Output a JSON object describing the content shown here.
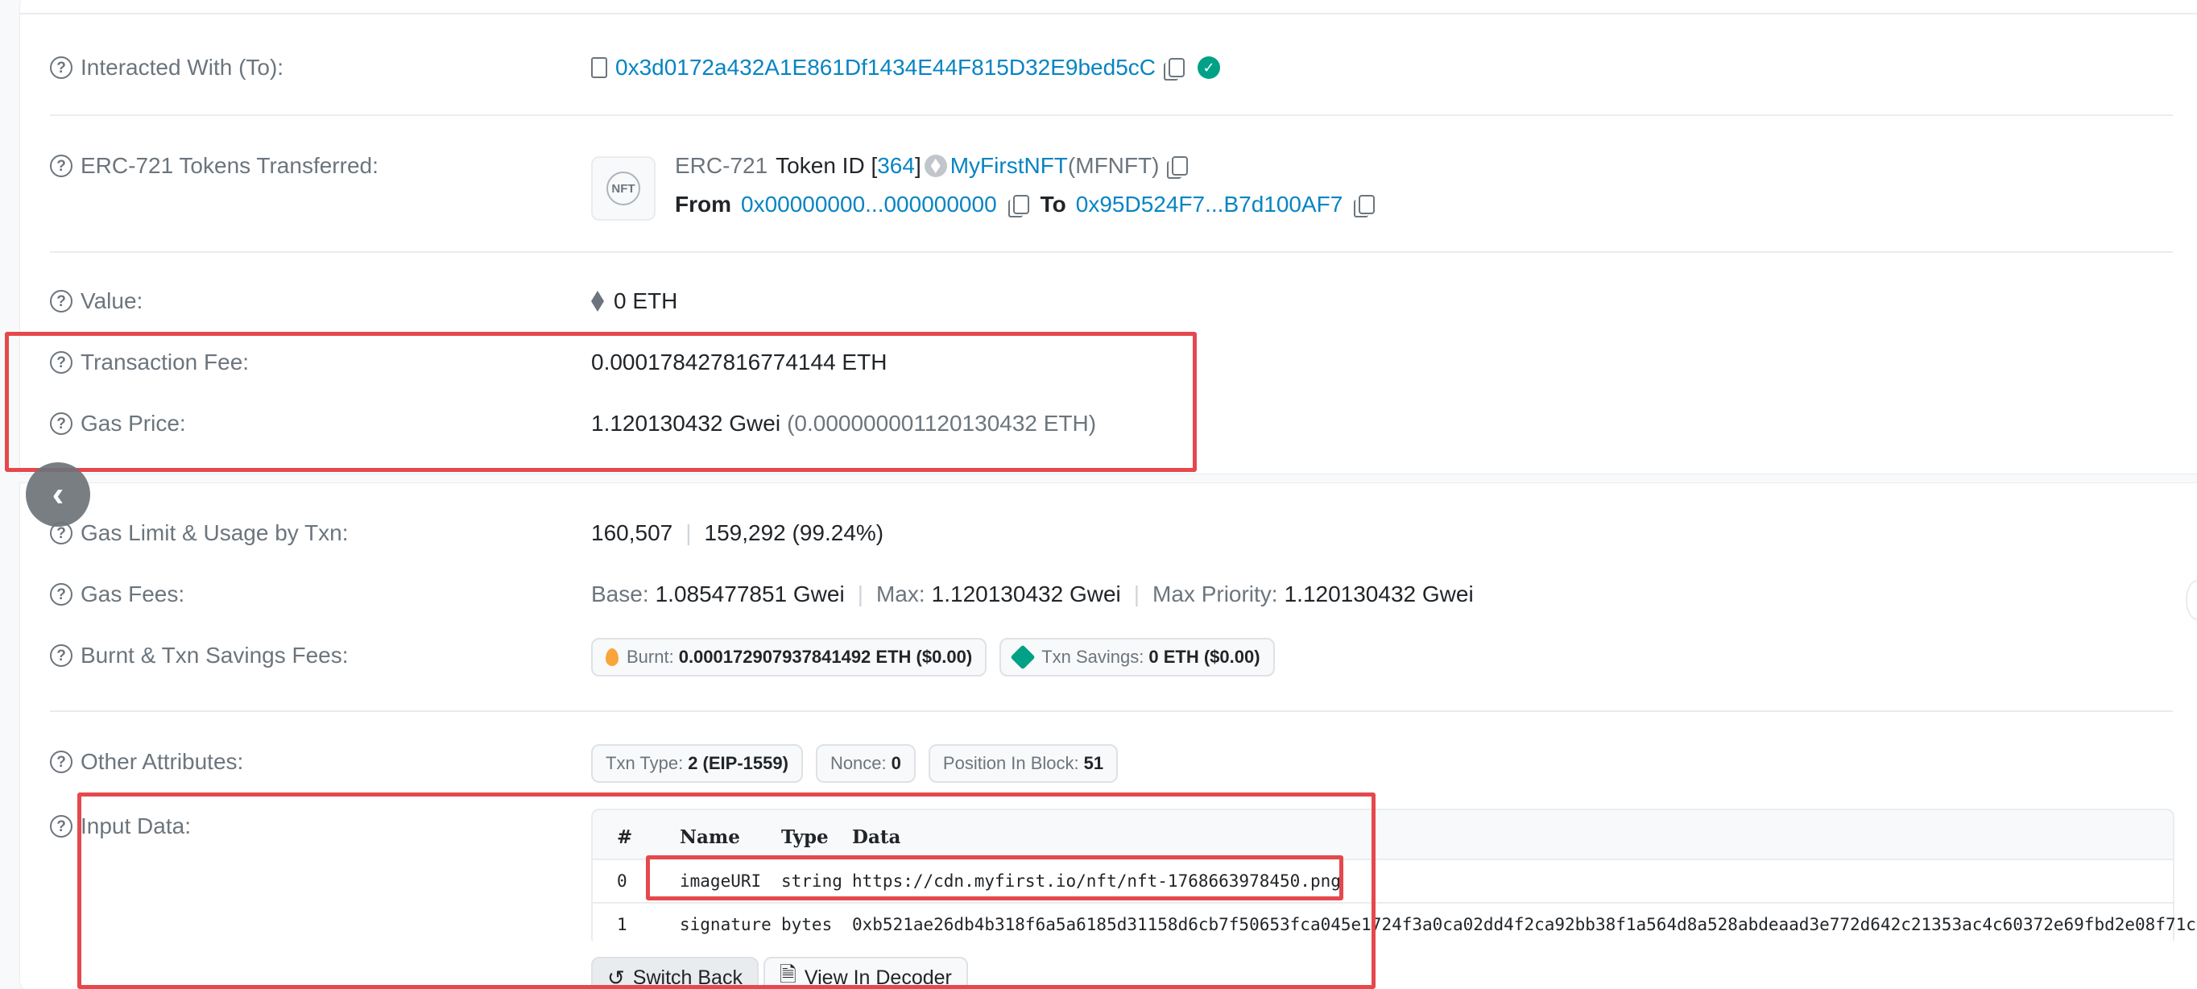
{
  "rows": {
    "interacted_with": {
      "label": "Interacted With (To):",
      "address": "0x3d0172a432A1E861Df1434E44F815D32E9bed5cC"
    },
    "erc721": {
      "label": "ERC-721 Tokens Transferred:",
      "standard": "ERC-721",
      "token_id_prefix": "Token ID [",
      "token_id": "364",
      "token_id_suffix": "]",
      "token_name": "MyFirstNFT",
      "token_symbol": "(MFNFT)",
      "from_label": "From",
      "from_address": "0x00000000...000000000",
      "to_label": "To",
      "to_address": "0x95D524F7...B7d100AF7",
      "thumbnail_text": "NFT"
    },
    "value": {
      "label": "Value:",
      "amount": "0 ETH"
    },
    "transaction_fee": {
      "label": "Transaction Fee:",
      "amount": "0.000178427816774144 ETH"
    },
    "gas_price": {
      "label": "Gas Price:",
      "gwei": "1.120130432 Gwei",
      "eth": "(0.000000001120130432 ETH)"
    },
    "gas_limit": {
      "label": "Gas Limit & Usage by Txn:",
      "limit": "160,507",
      "usage": "159,292 (99.24%)"
    },
    "gas_fees": {
      "label": "Gas Fees:",
      "base_label": "Base:",
      "base_value": "1.085477851 Gwei",
      "max_label": "Max:",
      "max_value": "1.120130432 Gwei",
      "priority_label": "Max Priority:",
      "priority_value": "1.120130432 Gwei"
    },
    "burnt": {
      "label": "Burnt & Txn Savings Fees:",
      "burnt_label": "Burnt:",
      "burnt_value": "0.000172907937841492 ETH ($0.00)",
      "savings_label": "Txn Savings:",
      "savings_value": "0 ETH ($0.00)"
    },
    "other_attributes": {
      "label": "Other Attributes:",
      "txn_type_label": "Txn Type:",
      "txn_type_value": "2 (EIP-1559)",
      "nonce_label": "Nonce:",
      "nonce_value": "0",
      "position_label": "Position In Block:",
      "position_value": "51"
    },
    "input_data": {
      "label": "Input Data:",
      "headers": [
        "#",
        "Name",
        "Type",
        "Data"
      ],
      "params": [
        {
          "index": "0",
          "name": "imageURI",
          "type": "string",
          "data": "https://cdn.myfirst.io/nft/nft-1768663978450.png"
        },
        {
          "index": "1",
          "name": "signature",
          "type": "bytes",
          "data": "0xb521ae26db4b318f6a5a6185d31158d6cb7f50653fca045e1724f3a0ca02dd4f2ca92bb38f1a564d8a528abdeaad3e772d642c21353ac4c60372e69fbd2e08f71c"
        }
      ],
      "switch_back_label": "Switch Back",
      "view_decoder_label": "View In Decoder"
    }
  },
  "colors": {
    "link": "#0784c3",
    "highlight": "#e5484d",
    "success": "#00a186"
  }
}
